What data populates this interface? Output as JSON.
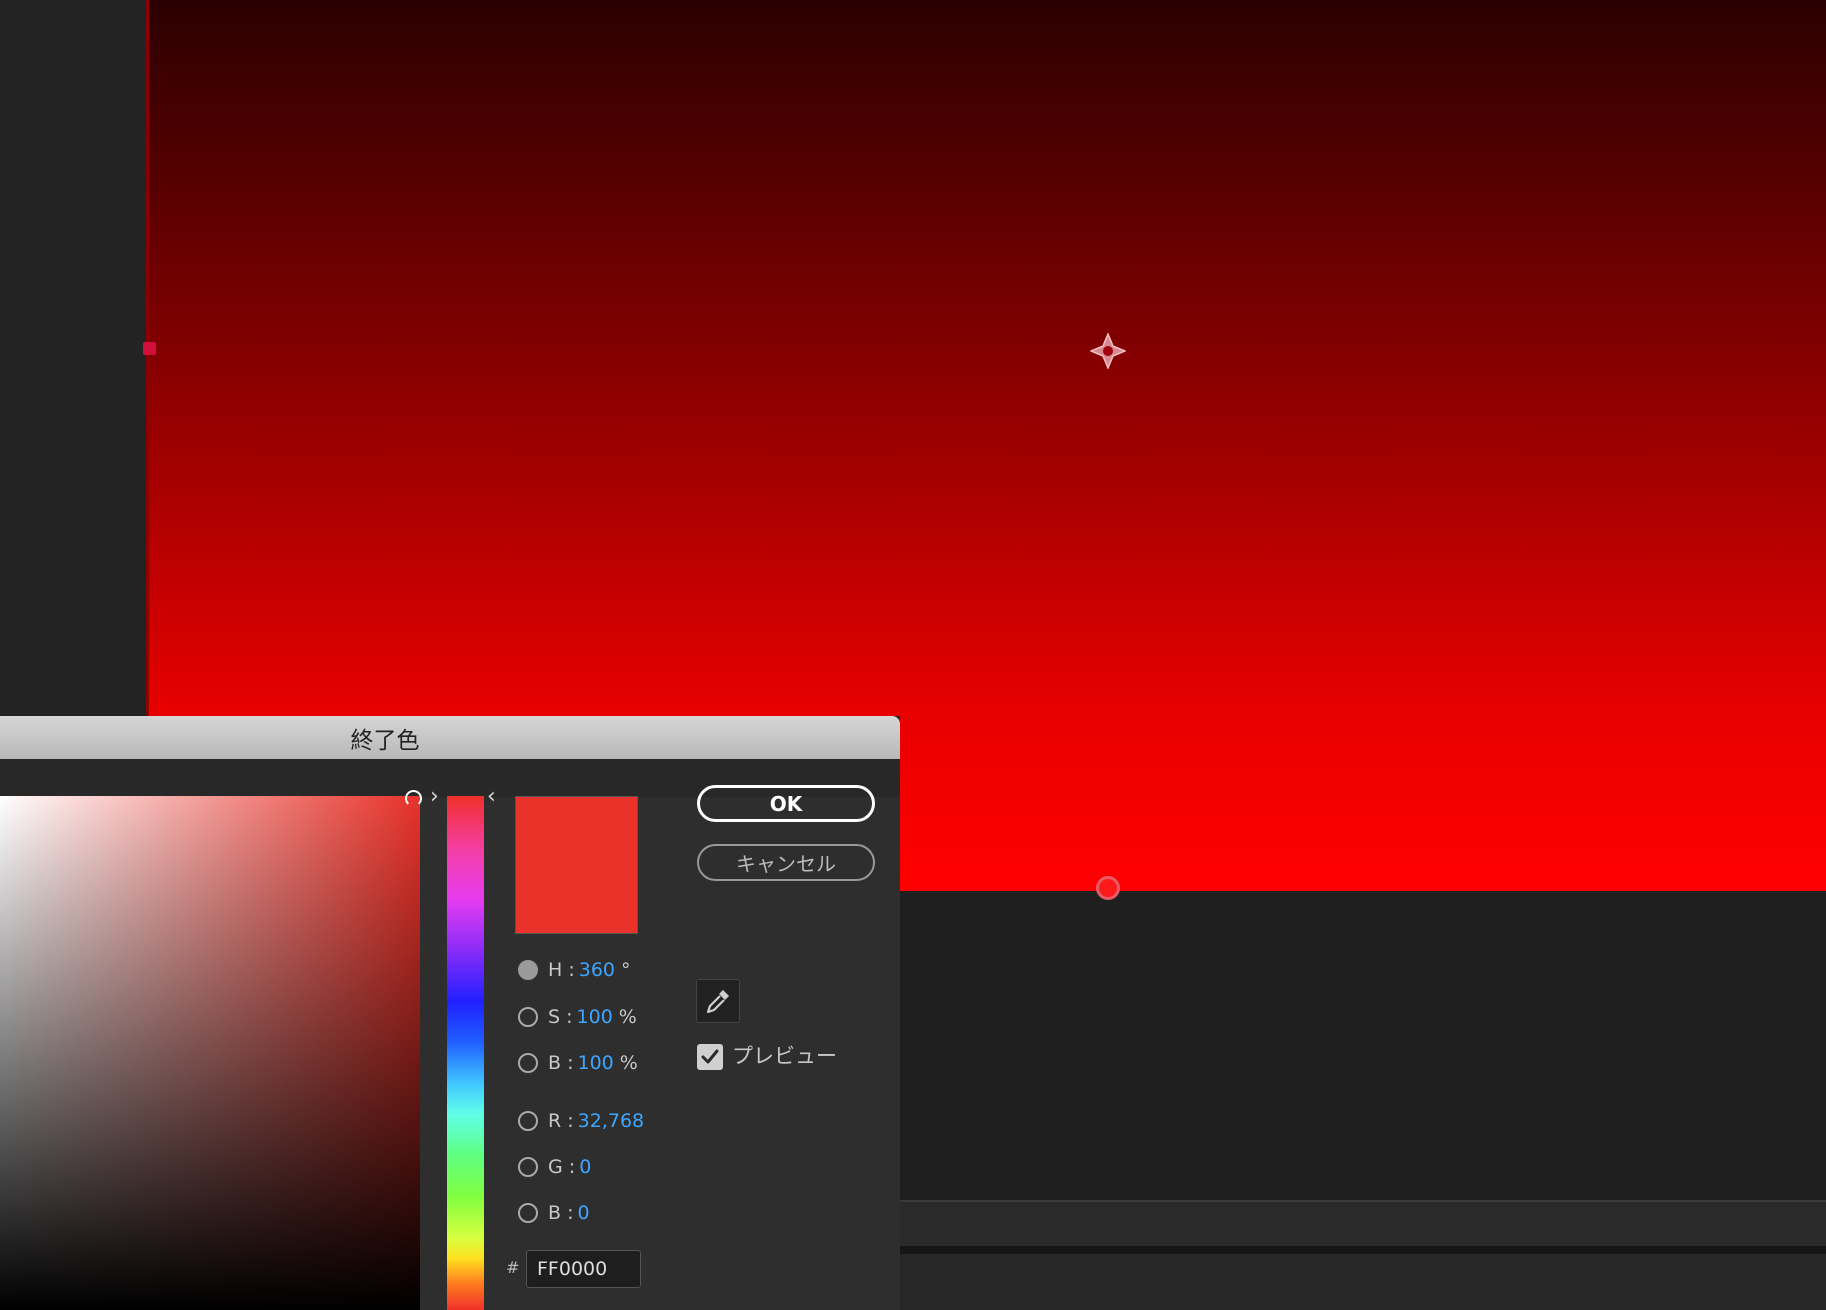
{
  "dialog": {
    "title": "終了色",
    "ok_label": "OK",
    "cancel_label": "キャンセル",
    "preview_label": "プレビュー",
    "preview_checked": true,
    "swatch_color": "#e8322a",
    "hue": {
      "label": "H",
      "value": "360",
      "unit": "°"
    },
    "saturation": {
      "label": "S",
      "value": "100",
      "unit": "%"
    },
    "brightness": {
      "label": "B",
      "value": "100",
      "unit": "%"
    },
    "red": {
      "label": "R",
      "value": "32,768"
    },
    "green": {
      "label": "G",
      "value": "0"
    },
    "blue": {
      "label": "B",
      "value": "0"
    },
    "hex": {
      "symbol": "#",
      "value": "FF0000"
    }
  },
  "colors": {
    "accent_value": "#3ea6ff",
    "canvas_end": "#ff0000",
    "handle": "#d0103a"
  }
}
